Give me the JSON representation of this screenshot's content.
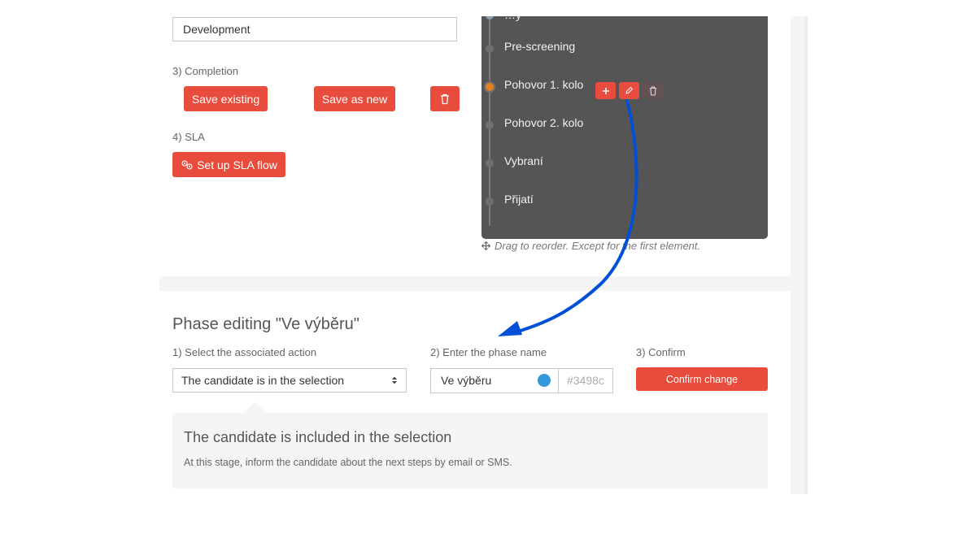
{
  "workflow_form": {
    "name_value": "Development",
    "completion_label": "3) Completion",
    "save_existing_label": "Save existing",
    "save_as_new_label": "Save as new",
    "delete_icon": "trash-icon",
    "sla_label": "4) SLA",
    "sla_button_label": "Set up SLA flow",
    "sla_icon": "gears-icon"
  },
  "phases_panel": {
    "partial_item": "…y",
    "items": [
      {
        "name": "Pre-screening",
        "active": false
      },
      {
        "name": "Pohovor 1. kolo",
        "active": true
      },
      {
        "name": "Pohovor 2. kolo",
        "active": false
      },
      {
        "name": "Vybraní",
        "active": false
      },
      {
        "name": "Přijatí",
        "active": false
      }
    ],
    "item_actions": {
      "add_icon": "plus-icon",
      "edit_icon": "pencil-icon",
      "delete_icon": "trash-icon"
    },
    "drag_hint": "Drag to reorder. Except for the first element.",
    "drag_icon": "move-icon"
  },
  "phase_editing": {
    "title": "Phase editing \"Ve výběru\"",
    "action_label": "1) Select the associated action",
    "action_selected": "The candidate is in the selection",
    "name_label": "2) Enter the phase name",
    "name_value": "Ve výběru",
    "color_value": "#3498c",
    "color_hex": "#3498db",
    "confirm_label": "3) Confirm",
    "confirm_button": "Confirm change",
    "info_title": "The candidate is included in the selection",
    "info_description": "At this stage, inform the candidate about the next steps by email or SMS."
  },
  "colors": {
    "accent": "#e74c3c",
    "panel": "#555555",
    "annotation_arrow": "#0050d8",
    "active_phase_dot": "#e67e22"
  }
}
